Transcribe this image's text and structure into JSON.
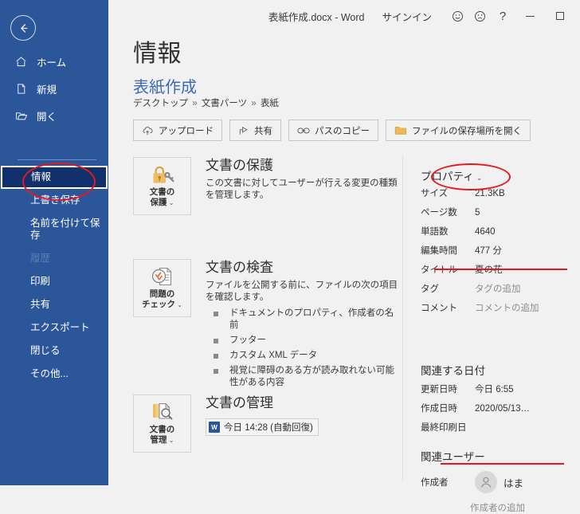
{
  "titlebar": {
    "document_title": "表紙作成.docx  -  Word",
    "signin_label": "サインイン",
    "happy_icon": "smiley-face-icon",
    "sad_icon": "frowny-face-icon",
    "help_label": "?",
    "minimize_label": "",
    "maximize_label": ""
  },
  "sidebar": {
    "back_icon": "back-arrow-icon",
    "top_items": [
      {
        "label": "ホーム",
        "icon": "home-icon"
      },
      {
        "label": "新規",
        "icon": "new-document-icon"
      },
      {
        "label": "開く",
        "icon": "open-folder-icon"
      }
    ],
    "items": [
      {
        "label": "情報",
        "selected": true,
        "disabled": false
      },
      {
        "label": "上書き保存",
        "selected": false,
        "disabled": false
      },
      {
        "label": "名前を付けて保存",
        "selected": false,
        "disabled": false
      },
      {
        "label": "履歴",
        "selected": false,
        "disabled": true
      },
      {
        "label": "印刷",
        "selected": false,
        "disabled": false
      },
      {
        "label": "共有",
        "selected": false,
        "disabled": false
      },
      {
        "label": "エクスポート",
        "selected": false,
        "disabled": false
      },
      {
        "label": "閉じる",
        "selected": false,
        "disabled": false
      },
      {
        "label": "その他...",
        "selected": false,
        "disabled": false
      }
    ]
  },
  "main": {
    "page_title": "情報",
    "doc_name": "表紙作成",
    "breadcrumb": {
      "part1": "デスクトップ",
      "part2": "文書パーツ",
      "part3": "表紙",
      "separator": "»"
    },
    "toolbar": [
      {
        "label": "アップロード",
        "icon": "cloud-upload-icon"
      },
      {
        "label": "共有",
        "icon": "share-icon"
      },
      {
        "label": "パスのコピー",
        "icon": "link-icon"
      },
      {
        "label": "ファイルの保存場所を開く",
        "icon": "folder-open-icon"
      }
    ],
    "cards": [
      {
        "button_caption_line1": "文書の",
        "button_caption_line2": "保護",
        "button_icon": "lock-key-icon",
        "title": "文書の保護",
        "desc": "この文書に対してユーザーが行える変更の種類を管理します。",
        "bullets": []
      },
      {
        "button_caption_line1": "問題の",
        "button_caption_line2": "チェック",
        "button_icon": "document-inspect-icon",
        "title": "文書の検査",
        "desc": "ファイルを公開する前に、ファイルの次の項目を確認します。",
        "bullets": [
          "ドキュメントのプロパティ、作成者の名前",
          "フッター",
          "カスタム XML データ",
          "視覚に障碍のある方が読み取れない可能性がある内容"
        ]
      },
      {
        "button_caption_line1": "文書の",
        "button_caption_line2": "管理",
        "button_icon": "document-manage-icon",
        "title": "文書の管理",
        "desc": "",
        "version_chip": {
          "icon": "word-file-icon",
          "label": "今日 14:28 (自動回復)"
        },
        "bullets": []
      }
    ]
  },
  "properties": {
    "heading": "プロパティ",
    "rows": [
      {
        "key": "サイズ",
        "value": "21.3KB",
        "placeholder": false
      },
      {
        "key": "ページ数",
        "value": "5",
        "placeholder": false
      },
      {
        "key": "単語数",
        "value": "4640",
        "placeholder": false
      },
      {
        "key": "編集時間",
        "value": "477 分",
        "placeholder": false
      },
      {
        "key": "タイトル",
        "value": "夏の花",
        "placeholder": false
      },
      {
        "key": "タグ",
        "value": "タグの追加",
        "placeholder": true
      },
      {
        "key": "コメント",
        "value": "コメントの追加",
        "placeholder": true
      }
    ]
  },
  "dates": {
    "heading": "関連する日付",
    "rows": [
      {
        "key": "更新日時",
        "value": "今日 6:55"
      },
      {
        "key": "作成日時",
        "value": "2020/05/13…"
      },
      {
        "key": "最終印刷日",
        "value": ""
      }
    ]
  },
  "users": {
    "heading": "関連ユーザー",
    "author_key": "作成者",
    "author_name": "はま",
    "author_avatar_icon": "person-avatar-icon",
    "add_author_label": "作成者の追加"
  },
  "annotations": {
    "accent_color": "#e8171b",
    "ellipse_sidebar_info": "情報",
    "ellipse_properties": "プロパティ",
    "underline_title_row": "タイトル 夏の花",
    "underline_author_row": "作成者 はま"
  }
}
